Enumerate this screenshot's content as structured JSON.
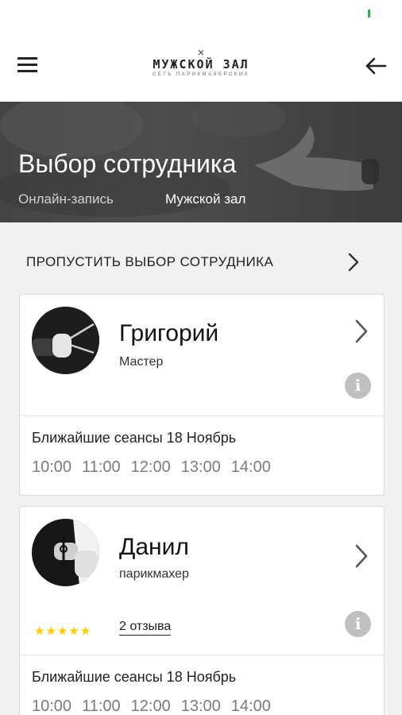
{
  "header": {
    "logo_title": "МУЖСКОЙ ЗАЛ",
    "logo_subtitle": "СЕТЬ ПАРИКМАХЕРСКИХ",
    "logo_mark": "✕"
  },
  "hero": {
    "title": "Выбор сотрудника",
    "breadcrumb": "Онлайн-запись",
    "salon": "Мужской зал"
  },
  "skip": {
    "label": "ПРОПУСТИТЬ ВЫБОР СОТРУДНИКА"
  },
  "employees": [
    {
      "name": "Григорий",
      "role": "Мастер",
      "sessions_label": "Ближайшие сеансы 18 Ноябрь",
      "slots": [
        "10:00",
        "11:00",
        "12:00",
        "13:00",
        "14:00"
      ]
    },
    {
      "name": "Данил",
      "role": "парикмахер",
      "rating": 5,
      "reviews": "2 отзыва",
      "sessions_label": "Ближайшие сеансы 18 Ноябрь",
      "slots": [
        "10:00",
        "11:00",
        "12:00",
        "13:00",
        "14:00"
      ]
    }
  ],
  "icons": {
    "star": "★",
    "info": "i"
  },
  "colors": {
    "star": "#ffcc00",
    "status_indicator": "#1cb84a",
    "hero_background": "#444444"
  }
}
